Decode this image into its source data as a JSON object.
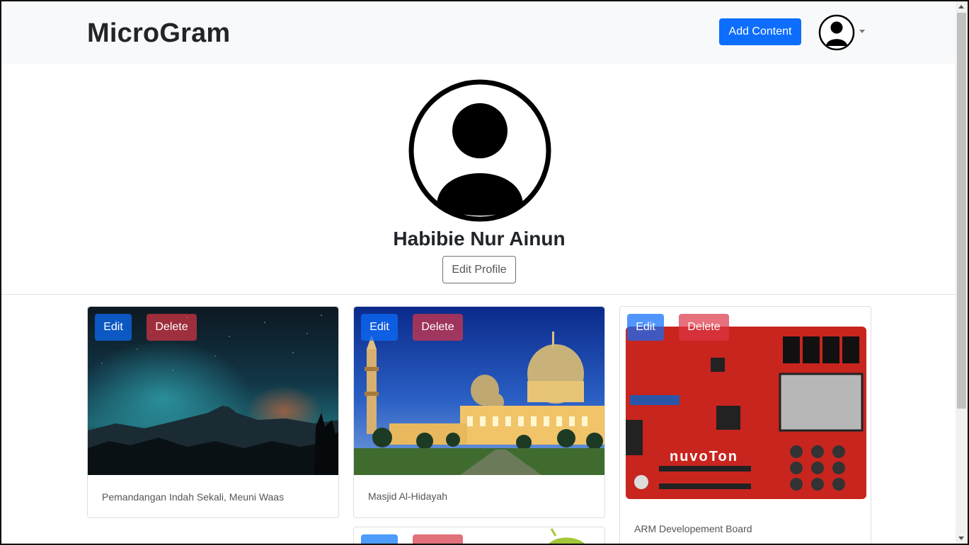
{
  "navbar": {
    "brand": "MicroGram",
    "add_content_label": "Add Content",
    "avatar_icon": "user-avatar-icon"
  },
  "profile": {
    "name": "Habibie Nur Ainun",
    "edit_profile_label": "Edit Profile"
  },
  "posts": [
    {
      "caption": "Pemandangan Indah Sekali, Meuni Waas",
      "edit_label": "Edit",
      "delete_label": "Delete"
    },
    {
      "caption": "Masjid Al-Hidayah",
      "edit_label": "Edit",
      "delete_label": "Delete"
    },
    {
      "caption": "ARM Developement Board",
      "edit_label": "Edit",
      "delete_label": "Delete"
    }
  ],
  "board_label": "nuvoTon",
  "colors": {
    "primary": "#0d6efd",
    "danger": "#dc3545",
    "navbar_bg": "#f8f9fa"
  }
}
